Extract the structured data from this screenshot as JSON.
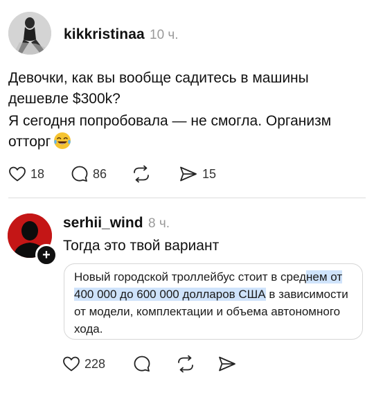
{
  "post": {
    "username": "kikkristinaa",
    "time": "10 ч.",
    "text_line1": "Девочки, как вы вообще садитесь в машины дешевле $300k?",
    "text_line2": "Я сегодня попробовала — не смогла. Организм отторг",
    "emoji": "laughing-with-tears-emoji",
    "likes": "18",
    "comments": "86",
    "reposts": "",
    "shares": "15"
  },
  "reply": {
    "username": "serhii_wind",
    "time": "8 ч.",
    "text": "Тогда это твой вариант",
    "quote": {
      "part_before": "Новый городской троллейбус стоит в сред",
      "part_highlight": "нем от 400 000 до 600 000 долларов США",
      "part_after": " в зависимости от модели, комплектации и объема автономного хода."
    },
    "likes": "228",
    "comments": "",
    "reposts": "",
    "shares": ""
  },
  "colors": {
    "text": "#111111",
    "muted": "#9a9a9a",
    "highlight": "#cfe3fb",
    "avatar_red": "#c41616",
    "divider": "#dcdcdc"
  }
}
